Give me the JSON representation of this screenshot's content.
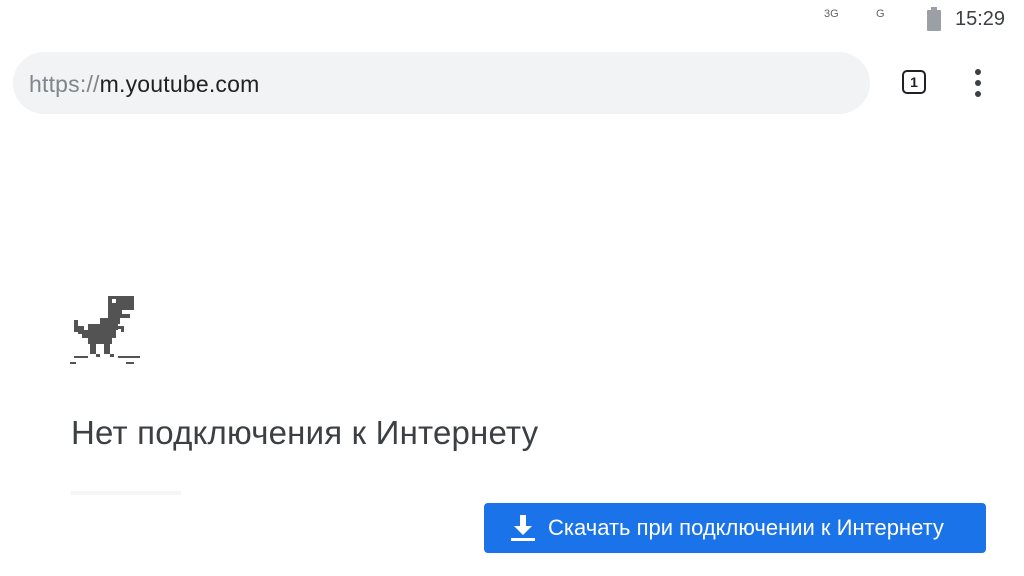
{
  "status_bar": {
    "signal_primary": "3G",
    "signal_secondary": "G",
    "time": "15:29",
    "battery_icon": "battery-icon"
  },
  "toolbar": {
    "url_scheme": "https://",
    "url_host": "m.youtube.com",
    "tab_count": "1",
    "menu_icon": "more-vert-icon"
  },
  "offline_page": {
    "illustration": "dino-icon",
    "headline": "Нет подключения к Интернету",
    "download_button_label": "Скачать при подключении к Интернету",
    "download_icon": "download-icon",
    "accent_color": "#1a73e8"
  }
}
